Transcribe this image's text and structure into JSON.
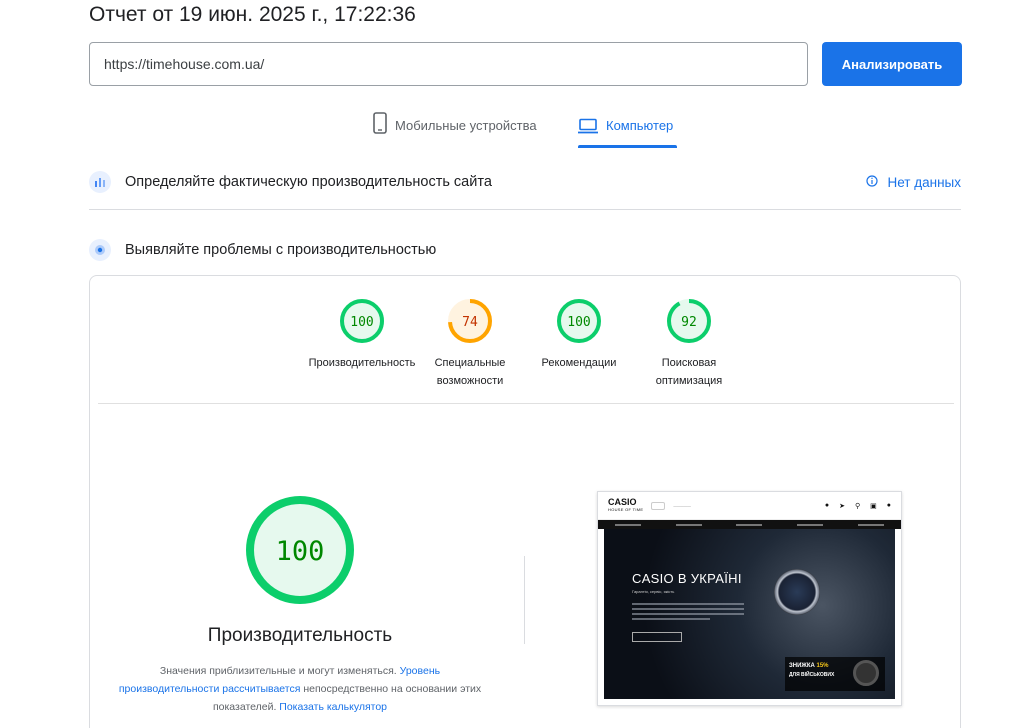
{
  "report": {
    "title": "Отчет от 19 июн. 2025 г., 17:22:36"
  },
  "search": {
    "url_value": "https://timehouse.com.ua/",
    "analyze_label": "Анализировать"
  },
  "tabs": [
    {
      "label": "Мобильные устройства",
      "icon": "smartphone-icon",
      "active": false
    },
    {
      "label": "Компьютер",
      "icon": "laptop-icon",
      "active": true
    }
  ],
  "sections": {
    "field_data": {
      "title": "Определяйте фактическую производительность сайта",
      "status": "Нет данных",
      "icon": "field-data-icon"
    },
    "lab_data": {
      "title": "Выявляйте проблемы с производительностью",
      "icon": "lab-data-icon"
    }
  },
  "scores": [
    {
      "value": "100",
      "score": 100,
      "label_lines": [
        "Производительность"
      ],
      "color": "#0cce6b",
      "text_color": "#008800",
      "fill": "#e6f9ee"
    },
    {
      "value": "74",
      "score": 74,
      "label_lines": [
        "Специальные",
        "возможности"
      ],
      "color": "#ffa400",
      "text_color": "#c33300",
      "fill": "#fff3e0"
    },
    {
      "value": "100",
      "score": 100,
      "label_lines": [
        "Рекомендации"
      ],
      "color": "#0cce6b",
      "text_color": "#008800",
      "fill": "#e6f9ee"
    },
    {
      "value": "92",
      "score": 92,
      "label_lines": [
        "Поисковая",
        "оптимизация"
      ],
      "color": "#0cce6b",
      "text_color": "#008800",
      "fill": "#e6f9ee"
    }
  ],
  "performance": {
    "score": "100",
    "title": "Производительность",
    "disclaimer": {
      "text1": "Значения приблизительные и могут изменяться. ",
      "link1": "Уровень производительности рассчитывается",
      "text2": " непосредственно на основании этих показателей. ",
      "link2": "Показать калькулятор"
    }
  },
  "screenshot": {
    "logo": "CASIO",
    "logo_sub": "HOUSE OF TIME",
    "hero_title": "CASIO В УКРАЇНІ",
    "hero_sub": "Гарантія, сервіс, якість",
    "sale_line1_a": "ЗНИЖКА ",
    "sale_line1_b": "15%",
    "sale_line2": "ДЛЯ ВІЙСЬКОВИХ"
  },
  "colors": {
    "accent": "#1a73e8",
    "pass": "#0cce6b",
    "average": "#ffa400"
  }
}
